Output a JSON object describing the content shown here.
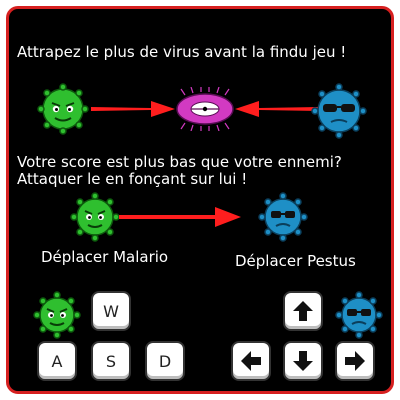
{
  "instructions": {
    "title": "Attrapez le plus de virus avant la findu jeu !",
    "score_line1": "Votre score est plus bas que votre ennemi?",
    "score_line2": "Attaquer le en fonçant sur lui !"
  },
  "labels": {
    "malario": "Déplacer Malario",
    "pestus": "Déplacer Pestus"
  },
  "controls": {
    "wasd": [
      "W",
      "A",
      "S",
      "D"
    ],
    "arrows": [
      "arrow-up-icon",
      "arrow-left-icon",
      "arrow-down-icon",
      "arrow-right-icon"
    ]
  },
  "colors": {
    "frame": "#d61f1f",
    "panel_bg": "#000000",
    "malario": "#2fbf2f",
    "pestus": "#1e8fc6",
    "virus": "#d23ac2",
    "arrow": "#ff1e1e"
  }
}
